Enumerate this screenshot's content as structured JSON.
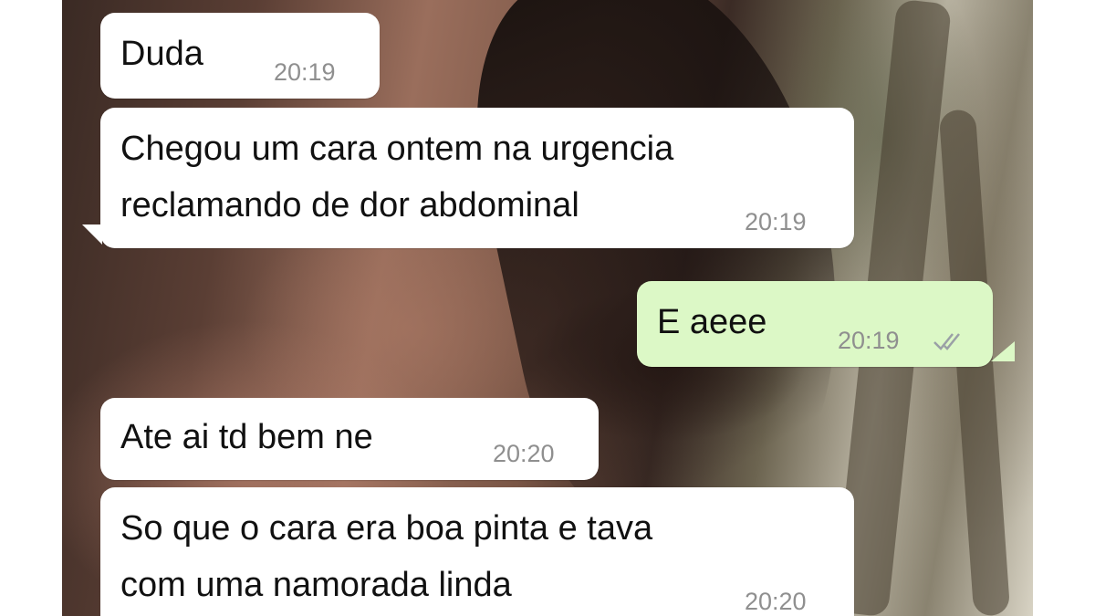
{
  "messages": [
    {
      "direction": "incoming",
      "text": "Duda",
      "time": "20:19"
    },
    {
      "direction": "incoming",
      "lines": [
        "Chegou um cara ontem na urgencia",
        "reclamando de dor abdominal"
      ],
      "time": "20:19"
    },
    {
      "direction": "outgoing",
      "text": "E aeee",
      "time": "20:19",
      "status_icon": "double-check-icon"
    },
    {
      "direction": "incoming",
      "text": "Ate ai td bem ne",
      "time": "20:20"
    },
    {
      "direction": "incoming",
      "lines": [
        "So que o cara era boa pinta e tava",
        "com uma namorada linda"
      ],
      "time": "20:20"
    }
  ],
  "colors": {
    "incoming_bubble": "#ffffff",
    "outgoing_bubble": "#dcf8c6",
    "timestamp": "#8f8f8f",
    "read_check": "#9aa0a6"
  }
}
